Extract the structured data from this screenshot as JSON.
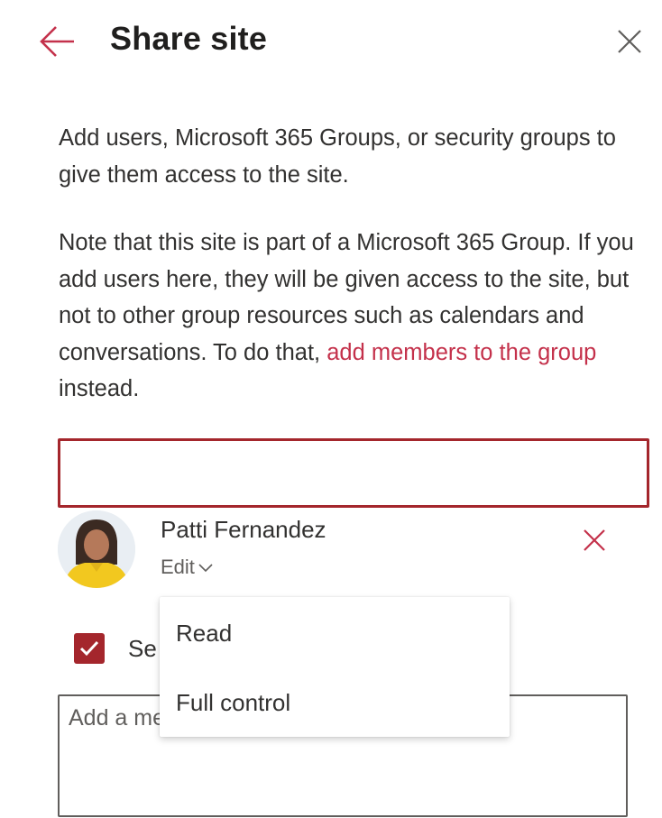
{
  "header": {
    "title": "Share site",
    "back_icon": "arrow-left-icon",
    "close_icon": "close-icon",
    "accent_color": "#c4314b"
  },
  "description": {
    "text": "Add users, Microsoft 365 Groups, or security groups to give them access to the site.",
    "note_text": "Note that this site is part of a Microsoft 365 Group. If you add users here, they will be given access to the site, but not to other group resources such as calendars and conversations. To do that, ",
    "note_link": "add members to the group",
    "note_suffix": " instead."
  },
  "people_picker": {
    "value": "",
    "border_color": "#a4262c"
  },
  "selected_person": {
    "name": "Patti Fernandez",
    "permission": "Edit",
    "avatar_icon": "user-photo",
    "remove_icon": "close-icon"
  },
  "permission_menu": {
    "options": [
      "Read",
      "Full control"
    ]
  },
  "send_email": {
    "checked": true,
    "label": "Se"
  },
  "message": {
    "placeholder": "Add a message"
  }
}
